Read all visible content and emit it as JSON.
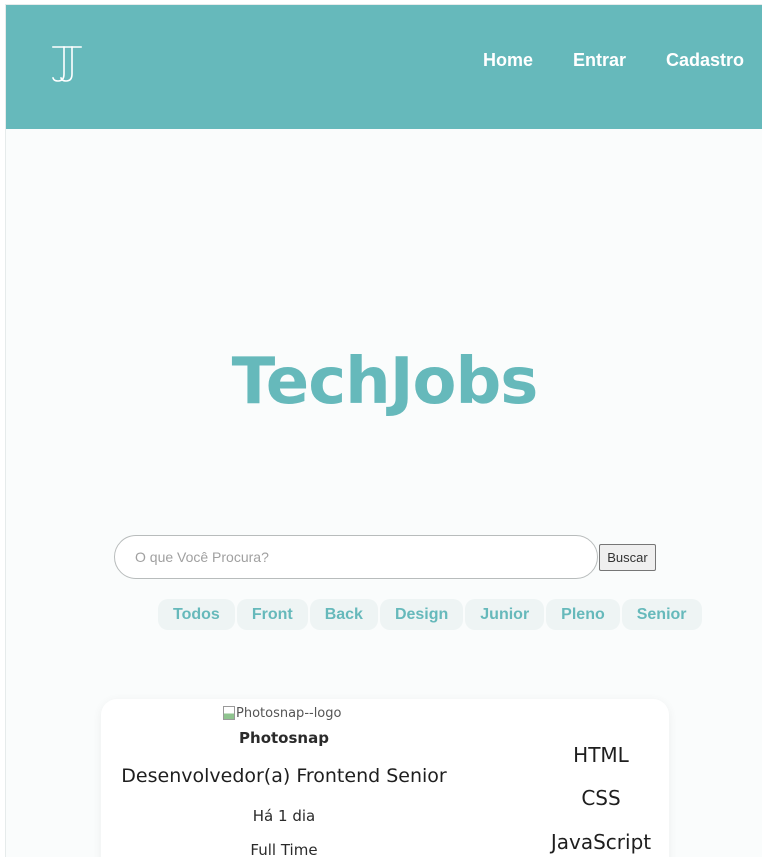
{
  "colors": {
    "brand": "#66b9bb",
    "nav_text": "#ffffff",
    "page_bg": "#fafcfc",
    "chip_bg": "#eef4f4"
  },
  "header": {
    "logo_icon": "jj-monogram-logo",
    "nav": [
      {
        "label": "Home"
      },
      {
        "label": "Entrar"
      },
      {
        "label": "Cadastro"
      }
    ]
  },
  "hero": {
    "title": "TechJobs"
  },
  "search": {
    "placeholder": "O que Você Procura?",
    "value": "",
    "button_label": "Buscar"
  },
  "filters": [
    {
      "label": "Todos"
    },
    {
      "label": "Front"
    },
    {
      "label": "Back"
    },
    {
      "label": "Design"
    },
    {
      "label": "Junior"
    },
    {
      "label": "Pleno"
    },
    {
      "label": "Senior"
    }
  ],
  "job": {
    "logo_alt": "Photosnap--logo",
    "company": "Photosnap",
    "title": "Desenvolvedor(a) Frontend Senior",
    "posted": "Há 1 dia",
    "type": "Full Time",
    "techs": [
      "HTML",
      "CSS",
      "JavaScript"
    ]
  }
}
